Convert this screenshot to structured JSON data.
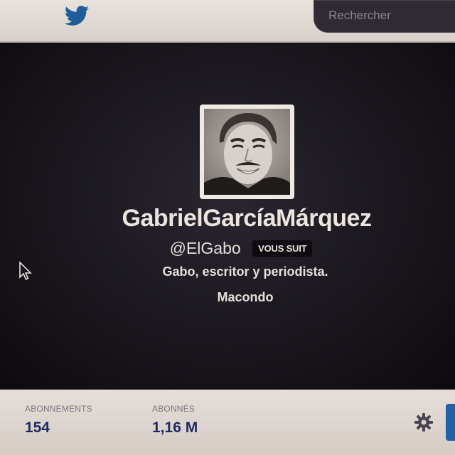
{
  "topbar": {
    "logo_icon": "twitter-bird-icon",
    "search": {
      "placeholder": "Rechercher",
      "value": ""
    }
  },
  "profile": {
    "avatar_icon": "profile-photo",
    "name": "GabrielGarcíaMárquez",
    "handle": "@ElGabo",
    "follows_you_badge": "VOUS SUIT",
    "bio": "Gabo, escritor y periodista.",
    "location": "Macondo"
  },
  "stats": {
    "following": {
      "label": "ABONNEMENTS",
      "value": "154"
    },
    "followers": {
      "label": "ABONNÉS",
      "value": "1,16 M"
    }
  },
  "actions": {
    "settings_icon": "gear-icon"
  },
  "colors": {
    "topbar": "#e0d8d3",
    "header_background": "#1c1920",
    "stat_value": "#1d2a63",
    "accent_blue": "#1f62a6"
  }
}
